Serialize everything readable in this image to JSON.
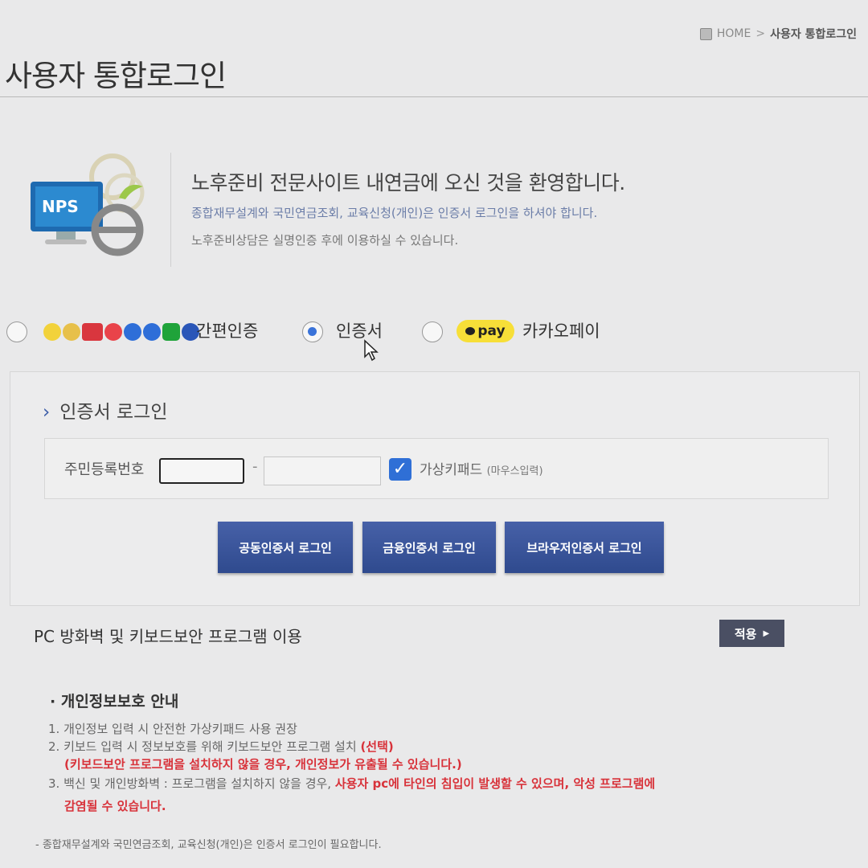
{
  "breadcrumb": {
    "home": "HOME",
    "sep": ">",
    "current": "사용자 통합로그인"
  },
  "page_title": "사용자 통합로그인",
  "welcome": {
    "logo_text": "NPS",
    "heading": "노후준비 전문사이트 내연금에 오신 것을 환영합니다.",
    "line1": "종합재무설계와 국민연금조회, 교육신청(개인)은 인증서 로그인을 하셔야 합니다.",
    "line2": "노후준비상담은 실명인증 후에 이용하실 수 있습니다."
  },
  "auth_options": {
    "simple": {
      "label": "간편인증",
      "selected": false
    },
    "cert": {
      "label": "인증서",
      "selected": true
    },
    "kakao": {
      "label": "카카오페이",
      "badge": "pay",
      "selected": false
    }
  },
  "login": {
    "section_title": "인증서 로그인",
    "id_label": "주민등록번호",
    "dash": "-",
    "id_part1": "",
    "id_part2": "",
    "virtual_keypad_label": "가상키패드",
    "virtual_keypad_note": "(마우스입력)",
    "virtual_keypad_checked": true,
    "buttons": {
      "joint_cert": "공동인증서 로그인",
      "financial_cert": "금융인증서 로그인",
      "browser_cert": "브라우저인증서 로그인"
    }
  },
  "firewall": {
    "label": "PC 방화벽 및 키보드보안 프로그램 이용",
    "apply": "적용"
  },
  "privacy": {
    "title": "개인정보보호 안내",
    "item1": "1. 개인정보 입력 시 안전한 가상키패드 사용 권장",
    "item2": "2. 키보드 입력 시 정보보호를 위해 키보드보안 프로그램 설치",
    "item2_tag": "(선택)",
    "item2_warning": "(키보드보안 프로그램을 설치하지 않을 경우, 개인정보가 유출될 수 있습니다.)",
    "item3": "3. 백신 및 개인방화벽 : 프로그램을 설치하지 않을 경우,",
    "item3_warning": "사용자 pc에 타인의 침입이 발생할 수 있으며, 악성 프로그램에",
    "item3_warning2": "감염될 수 있습니다."
  },
  "footer_note": "- 종합재무설계와 국민연금조회, 교육신청(개인)은 인증서 로그인이 필요합니다."
}
